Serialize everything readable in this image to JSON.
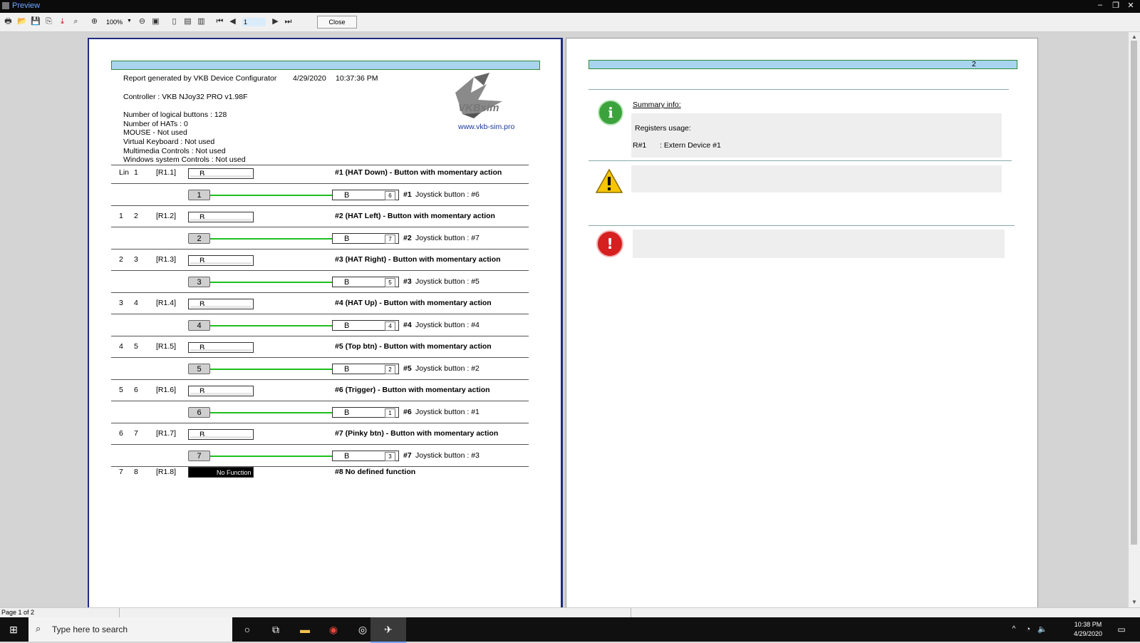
{
  "window": {
    "title": "Preview"
  },
  "toolbar": {
    "zoom": "100%",
    "page": "1",
    "close_label": "Close"
  },
  "report": {
    "header_line": "Report generated by VKB Device Configurator",
    "date": "4/29/2020",
    "time": "10:37:36 PM",
    "controller": "Controller :  VKB NJoy32 PRO   v1.98F",
    "info_lines": [
      "Number of logical buttons :  128",
      "Number of HATs :  0",
      "MOUSE - Not used",
      "Virtual Keyboard :  Not used",
      "Multimedia Controls :  Not used",
      "Windows system Controls :  Not used"
    ],
    "logo_text": "VKBsim",
    "website": "www.vkb-sim.pro",
    "rows": [
      {
        "lin": "Lin",
        "num": "1",
        "reg": "[R1.1]",
        "btn": "B",
        "desc": "#1 (HAT Down) - Button with momentary action",
        "map_num": "1",
        "jb_label": "B",
        "jb_num": "6",
        "jdesc_id": "#1",
        "jdesc": "Joystick button : #6"
      },
      {
        "lin": "1",
        "num": "2",
        "reg": "[R1.2]",
        "btn": "B",
        "desc": "#2 (HAT Left) - Button with momentary action",
        "map_num": "2",
        "jb_label": "B",
        "jb_num": "7",
        "jdesc_id": "#2",
        "jdesc": "Joystick button : #7"
      },
      {
        "lin": "2",
        "num": "3",
        "reg": "[R1.3]",
        "btn": "B",
        "desc": "#3 (HAT Right) - Button with momentary action",
        "map_num": "3",
        "jb_label": "B",
        "jb_num": "5",
        "jdesc_id": "#3",
        "jdesc": "Joystick button : #5"
      },
      {
        "lin": "3",
        "num": "4",
        "reg": "[R1.4]",
        "btn": "B",
        "desc": "#4 (HAT Up) - Button with momentary action",
        "map_num": "4",
        "jb_label": "B",
        "jb_num": "4",
        "jdesc_id": "#4",
        "jdesc": "Joystick button : #4"
      },
      {
        "lin": "4",
        "num": "5",
        "reg": "[R1.5]",
        "btn": "B",
        "desc": "#5 (Top btn) - Button with momentary action",
        "map_num": "5",
        "jb_label": "B",
        "jb_num": "2",
        "jdesc_id": "#5",
        "jdesc": "Joystick button : #2"
      },
      {
        "lin": "5",
        "num": "6",
        "reg": "[R1.6]",
        "btn": "B",
        "desc": "#6 (Trigger) - Button with momentary action",
        "map_num": "6",
        "jb_label": "B",
        "jb_num": "1",
        "jdesc_id": "#6",
        "jdesc": "Joystick button : #1"
      },
      {
        "lin": "6",
        "num": "7",
        "reg": "[R1.7]",
        "btn": "B",
        "desc": "#7 (Pinky btn) - Button with momentary action",
        "map_num": "7",
        "jb_label": "B",
        "jb_num": "3",
        "jdesc_id": "#7",
        "jdesc": "Joystick button : #3"
      }
    ],
    "last_row": {
      "lin": "7",
      "num": "8",
      "reg": "[R1.8]",
      "btn": "No Function",
      "desc": "#8  No defined function"
    }
  },
  "page2": {
    "page_number": "2",
    "summary_title": "Summary info:",
    "registers_label": "Registers usage:",
    "register_id": "R#1",
    "register_value": ":  Extern Device #1"
  },
  "status": {
    "page_info": "Page 1 of 2"
  },
  "taskbar": {
    "search_placeholder": "Type here to search",
    "time": "10:38 PM",
    "date": "4/29/2020"
  },
  "colors": {
    "link_blue": "#1a3a9c",
    "mapping_green": "#1fbf1f",
    "page_band": "#a9d4ef"
  }
}
